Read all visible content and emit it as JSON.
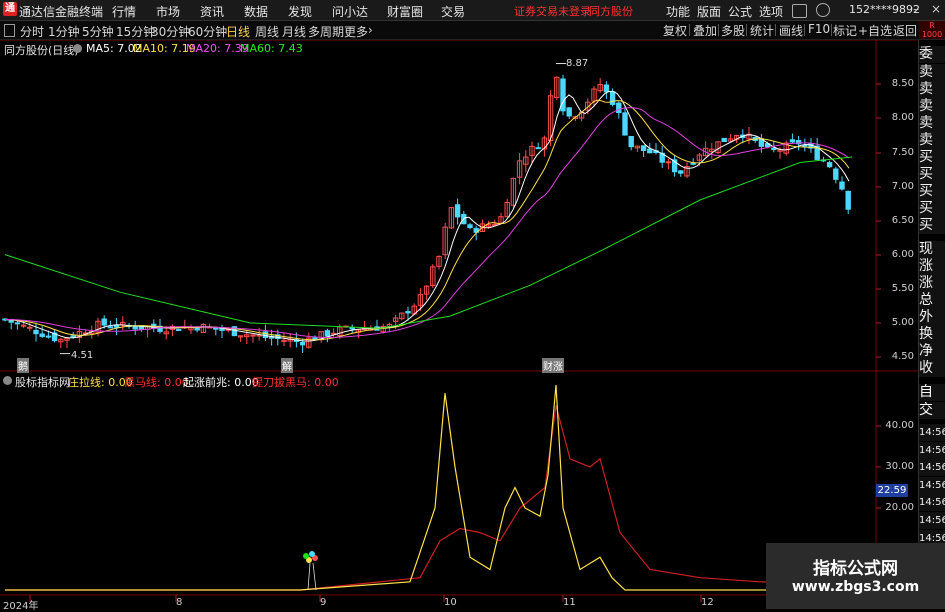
{
  "titlebar": {
    "app_name": "通达信金融终端",
    "menus": [
      "行情",
      "市场",
      "资讯",
      "数据",
      "发现",
      "问小达",
      "财富圈",
      "交易"
    ],
    "warning": "证券交易未登录",
    "stock_name": "同方股份",
    "right_menus": [
      "功能",
      "版面",
      "公式",
      "选项"
    ],
    "user": "152****9892"
  },
  "toolbar": {
    "periods": [
      "分时",
      "1分钟",
      "5分钟",
      "15分钟",
      "30分钟",
      "60分钟",
      "日线",
      "周线",
      "月线",
      "多周期",
      "更多"
    ],
    "active_period": "日线",
    "buttons": [
      "复权",
      "叠加",
      "多股",
      "统计",
      "画线",
      "F10",
      "+自选",
      "标记",
      "返回"
    ]
  },
  "main_chart": {
    "title": "同方股份(日线)",
    "ma_labels": [
      {
        "label": "MA5: 7.02",
        "color": "#ffffff"
      },
      {
        "label": "MA10: 7.19",
        "color": "#ffe14a"
      },
      {
        "label": "MA20: 7.39",
        "color": "#ff4cff"
      },
      {
        "label": "MA60: 7.43",
        "color": "#22ee22"
      }
    ],
    "high_label": "8.87",
    "low_label": "4.51",
    "markers": [
      "鹅",
      "解",
      "财涨"
    ],
    "y_ticks": [
      "8.50",
      "8.00",
      "7.50",
      "7.00",
      "6.50",
      "6.00",
      "5.50",
      "5.00",
      "4.50"
    ]
  },
  "indicator": {
    "title": "股标指标网",
    "lines": [
      {
        "label": "庄拉线: 0.00",
        "color": "#ffe14a"
      },
      {
        "label": "黑马线: 0.00",
        "color": "#ff3030"
      },
      {
        "label": "起涨前兆: 0.00",
        "color": "#ffffff"
      },
      {
        "label": "提刀拔黑马: 0.00",
        "color": "#ff3030"
      }
    ],
    "y_ticks": [
      "40.00",
      "30.00",
      "20.00"
    ],
    "current_value": "22.59"
  },
  "x_axis": {
    "labels": [
      "2024年",
      "8",
      "9",
      "10",
      "11",
      "12"
    ]
  },
  "sidebar": {
    "items": [
      "委比",
      "卖五",
      "卖四",
      "卖三",
      "卖二",
      "卖一",
      "买一",
      "买二",
      "买三",
      "买四",
      "买五",
      "现价",
      "涨跌",
      "涨幅",
      "总量",
      "外盘",
      "换手",
      "净资",
      "收益"
    ],
    "tabs": [
      "自动",
      "交易"
    ],
    "times": [
      "14:56",
      "14:56",
      "14:56",
      "14:56",
      "14:56",
      "14:56",
      "14:56",
      "14:56",
      "14:56"
    ]
  },
  "watermark": {
    "line1": "指标公式网",
    "line2": "www.zbgs3.com"
  },
  "colors": {
    "up": "#ff4c4c",
    "down": "#4ad8ff",
    "ma5": "#ffffff",
    "ma10": "#ffe14a",
    "ma20": "#e040e0",
    "ma60": "#22dd22",
    "grid": "#7a0000"
  }
}
